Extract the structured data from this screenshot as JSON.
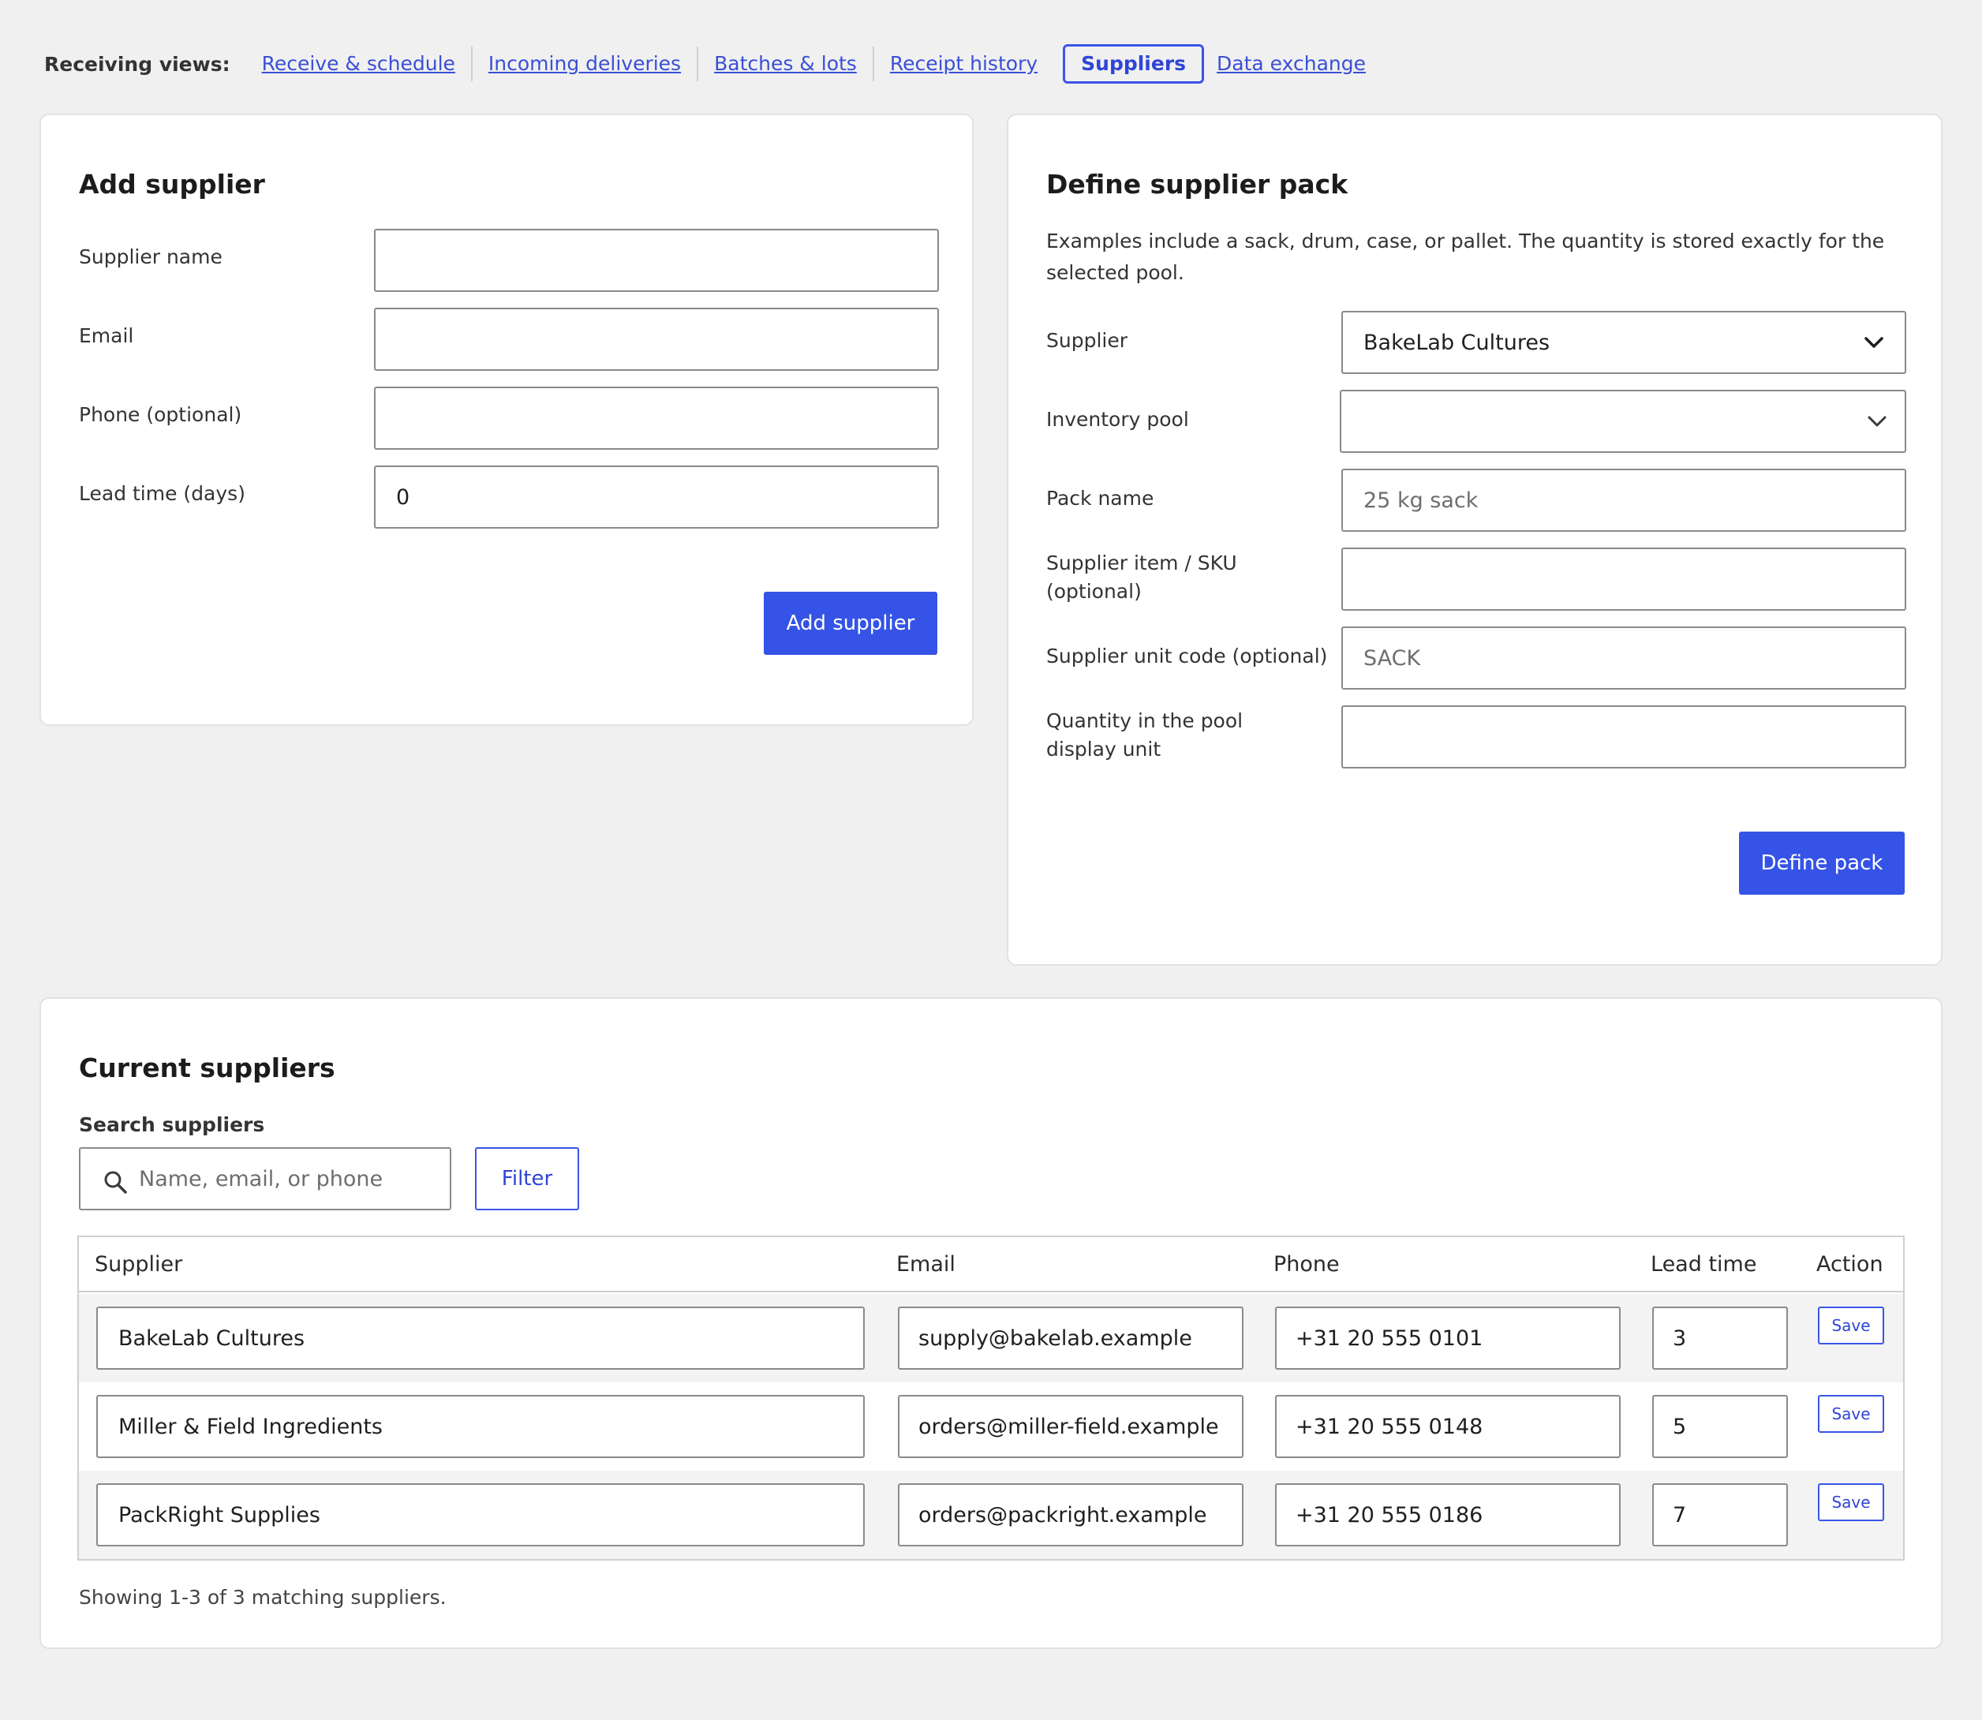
{
  "nav": {
    "label": "Receiving views:",
    "links": [
      "Receive & schedule",
      "Incoming deliveries",
      "Batches & lots",
      "Receipt history"
    ],
    "active": "Suppliers",
    "last": "Data exchange"
  },
  "add_supplier": {
    "title": "Add supplier",
    "fields": {
      "name_label": "Supplier name",
      "name_value": "",
      "email_label": "Email",
      "email_value": "",
      "phone_label": "Phone (optional)",
      "phone_value": "",
      "lead_label": "Lead time (days)",
      "lead_value": "0"
    },
    "button": "Add supplier"
  },
  "define_pack": {
    "title": "Define supplier pack",
    "description": "Examples include a sack, drum, case, or pallet. The quantity is stored exactly for the selected pool.",
    "supplier_label": "Supplier",
    "supplier_value": "BakeLab Cultures",
    "pool_label": "Inventory pool",
    "pool_value": "",
    "pack_name_label": "Pack name",
    "pack_name_placeholder": "25 kg sack",
    "sku_label": "Supplier item / SKU (optional)",
    "sku_value": "",
    "unit_code_label": "Supplier unit code (optional)",
    "unit_code_placeholder": "SACK",
    "qty_label": "Quantity in the pool display unit",
    "qty_value": "",
    "button": "Define pack"
  },
  "current": {
    "title": "Current suppliers",
    "search_label": "Search suppliers",
    "search_placeholder": "Name, email, or phone",
    "filter_button": "Filter",
    "columns": [
      "Supplier",
      "Email",
      "Phone",
      "Lead time",
      "Action"
    ],
    "rows": [
      {
        "name": "BakeLab Cultures",
        "email": "supply@bakelab.example",
        "phone": "+31 20 555 0101",
        "lead": "3",
        "action": "Save"
      },
      {
        "name": "Miller & Field Ingredients",
        "email": "orders@miller-field.example",
        "phone": "+31 20 555 0148",
        "lead": "5",
        "action": "Save"
      },
      {
        "name": "PackRight Supplies",
        "email": "orders@packright.example",
        "phone": "+31 20 555 0186",
        "lead": "7",
        "action": "Save"
      }
    ],
    "footnote": "Showing 1-3 of 3 matching suppliers."
  },
  "icons": {
    "search": "search-icon",
    "chevron": "chevron-down-icon"
  },
  "colors": {
    "primary": "#3553e6",
    "link": "#3a4fd6",
    "background": "#f0f0f0"
  }
}
